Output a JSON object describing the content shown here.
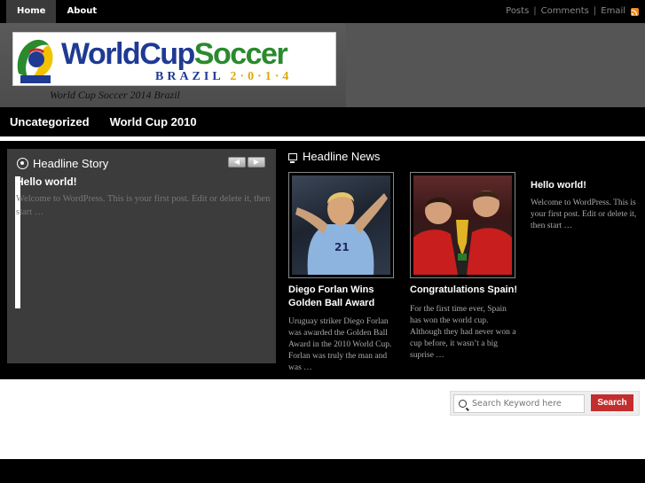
{
  "topbar": {
    "nav": [
      {
        "label": "Home"
      },
      {
        "label": "About"
      }
    ],
    "links": {
      "posts": "Posts",
      "comments": "Comments",
      "email": "Email"
    }
  },
  "header": {
    "logo": {
      "title_blue": "WorldCup",
      "title_green": "Soccer",
      "subtitle_brazil": "BRAZIL",
      "subtitle_year": "2·0·1·4"
    },
    "tagline": "World Cup Soccer 2014 Brazil"
  },
  "mainnav": [
    {
      "label": "Uncategorized"
    },
    {
      "label": "World Cup 2010"
    }
  ],
  "headline_story": {
    "heading": "Headline Story",
    "prev_arrow": "◀",
    "next_arrow": "▶",
    "post_title": "Hello world!",
    "post_excerpt": "Welcome to WordPress. This is your first post. Edit or delete it, then start …"
  },
  "headline_news": {
    "heading": "Headline News",
    "items": [
      {
        "title": "Diego Forlan Wins Golden Ball Award",
        "excerpt": "Uruguay striker Diego Forlan was awarded the Golden Ball Award in the 2010 World Cup. Forlan was truly the man and was …"
      },
      {
        "title": "Congratulations Spain!",
        "excerpt": "For the first time ever, Spain has won the world cup. Although they had never won a cup before, it wasn’t a big suprise …"
      },
      {
        "title": "Hello world!",
        "excerpt": "Welcome to WordPress. This is your first post. Edit or delete it, then start …"
      }
    ]
  },
  "search": {
    "placeholder": "Search Keyword here",
    "button": "Search"
  }
}
